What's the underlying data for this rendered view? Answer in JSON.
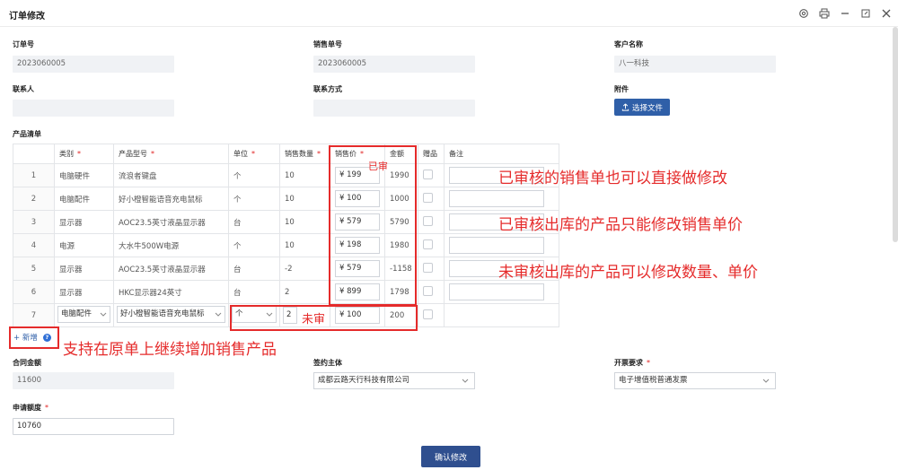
{
  "window": {
    "title": "订单修改"
  },
  "fields": {
    "order_no": {
      "label": "订单号",
      "value": "2023060005"
    },
    "sales_no": {
      "label": "销售单号",
      "value": "2023060005"
    },
    "customer": {
      "label": "客户名称",
      "value": "八一科技"
    },
    "contact": {
      "label": "联系人",
      "value": ""
    },
    "contact_info": {
      "label": "联系方式",
      "value": ""
    },
    "attachment": {
      "label": "附件",
      "button": "选择文件"
    }
  },
  "products": {
    "section_label": "产品清单",
    "headers": [
      "类别",
      "产品型号",
      "单位",
      "销售数量",
      "销售价",
      "金额",
      "赠品",
      "备注"
    ],
    "rows": [
      {
        "n": "1",
        "category": "电脑硬件",
        "model": "流浪者键盘",
        "unit": "个",
        "qty": "10",
        "price": "199",
        "amount": "1990"
      },
      {
        "n": "2",
        "category": "电脑配件",
        "model": "好小橙智能语音充电鼠标",
        "unit": "个",
        "qty": "10",
        "price": "100",
        "amount": "1000"
      },
      {
        "n": "3",
        "category": "显示器",
        "model": "AOC23.5英寸液晶显示器",
        "unit": "台",
        "qty": "10",
        "price": "579",
        "amount": "5790"
      },
      {
        "n": "4",
        "category": "电源",
        "model": "大水牛500W电源",
        "unit": "个",
        "qty": "10",
        "price": "198",
        "amount": "1980"
      },
      {
        "n": "5",
        "category": "显示器",
        "model": "AOC23.5英寸液晶显示器",
        "unit": "台",
        "qty": "-2",
        "price": "579",
        "amount": "-1158"
      },
      {
        "n": "6",
        "category": "显示器",
        "model": "HKC显示器24英寸",
        "unit": "台",
        "qty": "2",
        "price": "899",
        "amount": "1798"
      }
    ],
    "edit_row": {
      "n": "7",
      "category": "电脑配件",
      "model": "好小橙智能语音充电鼠标",
      "unit": "个",
      "qty": "2",
      "price": "100",
      "amount": "200"
    },
    "currency": "¥",
    "add_label": "+ 新增"
  },
  "bottom": {
    "contract_amount": {
      "label": "合同金额",
      "value": "11600"
    },
    "signing_entity": {
      "label": "签约主体",
      "value": "成都云路天行科技有限公司"
    },
    "invoice": {
      "label": "开票要求",
      "value": "电子增值税普通发票"
    },
    "applied_amount": {
      "label": "申请额度",
      "value": "10760"
    }
  },
  "confirm_button": "确认修改",
  "annotations": {
    "approved_tag": "已审",
    "unapproved_tag": "未审",
    "note1": "已审核的销售单也可以直接做修改",
    "note2": "已审核出库的产品只能修改销售单价",
    "note3": "未审核出库的产品可以修改数量、单价",
    "note4": "支持在原单上继续增加销售产品"
  },
  "colors": {
    "accent": "#2f5fa8",
    "annotation": "#e52b2b",
    "required": "#e02020"
  }
}
